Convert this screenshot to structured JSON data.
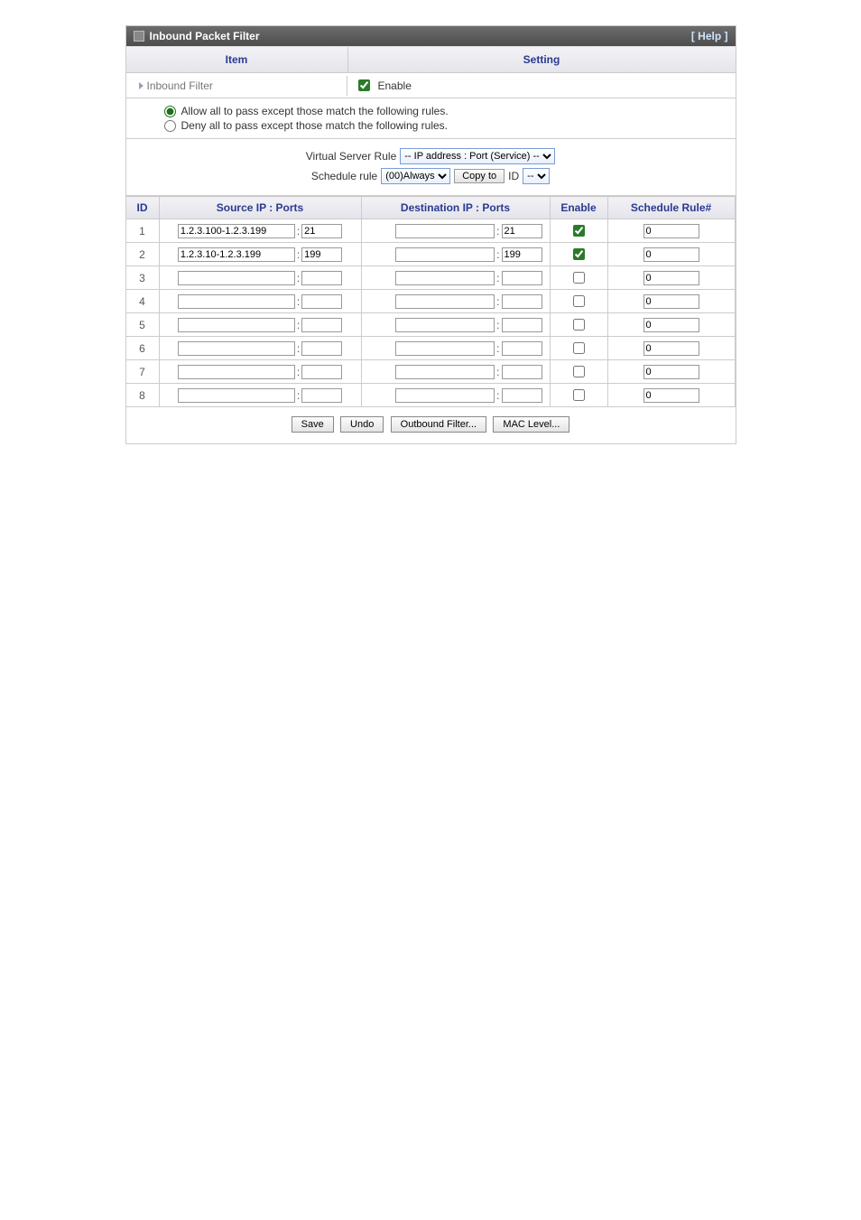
{
  "header": {
    "title": "Inbound Packet Filter",
    "help": "[ Help ]"
  },
  "columns": {
    "item": "Item",
    "setting": "Setting"
  },
  "inbound": {
    "label": "Inbound Filter",
    "enable_label": "Enable",
    "enabled": true
  },
  "policy": {
    "allow": "Allow all to pass except those match the following rules.",
    "deny": "Deny all to pass except those match the following rules.",
    "selected": "allow"
  },
  "vsr": {
    "label": "Virtual Server Rule",
    "option": "-- IP address : Port (Service) --",
    "sched_label": "Schedule rule",
    "sched_option": "(00)Always",
    "copy_label": "Copy to",
    "id_label": "ID",
    "id_option": "--"
  },
  "rules_header": {
    "id": "ID",
    "src": "Source IP : Ports",
    "dst": "Destination IP : Ports",
    "enable": "Enable",
    "sched": "Schedule Rule#"
  },
  "rules": [
    {
      "id": "1",
      "src_ip": "1.2.3.100-1.2.3.199",
      "src_port": "21",
      "dst_ip": "",
      "dst_port": "21",
      "enabled": true,
      "sched": "0"
    },
    {
      "id": "2",
      "src_ip": "1.2.3.10-1.2.3.199",
      "src_port": "199",
      "dst_ip": "",
      "dst_port": "199",
      "enabled": true,
      "sched": "0"
    },
    {
      "id": "3",
      "src_ip": "",
      "src_port": "",
      "dst_ip": "",
      "dst_port": "",
      "enabled": false,
      "sched": "0"
    },
    {
      "id": "4",
      "src_ip": "",
      "src_port": "",
      "dst_ip": "",
      "dst_port": "",
      "enabled": false,
      "sched": "0"
    },
    {
      "id": "5",
      "src_ip": "",
      "src_port": "",
      "dst_ip": "",
      "dst_port": "",
      "enabled": false,
      "sched": "0"
    },
    {
      "id": "6",
      "src_ip": "",
      "src_port": "",
      "dst_ip": "",
      "dst_port": "",
      "enabled": false,
      "sched": "0"
    },
    {
      "id": "7",
      "src_ip": "",
      "src_port": "",
      "dst_ip": "",
      "dst_port": "",
      "enabled": false,
      "sched": "0"
    },
    {
      "id": "8",
      "src_ip": "",
      "src_port": "",
      "dst_ip": "",
      "dst_port": "",
      "enabled": false,
      "sched": "0"
    }
  ],
  "buttons": {
    "save": "Save",
    "undo": "Undo",
    "outbound": "Outbound Filter...",
    "mac": "MAC Level..."
  }
}
